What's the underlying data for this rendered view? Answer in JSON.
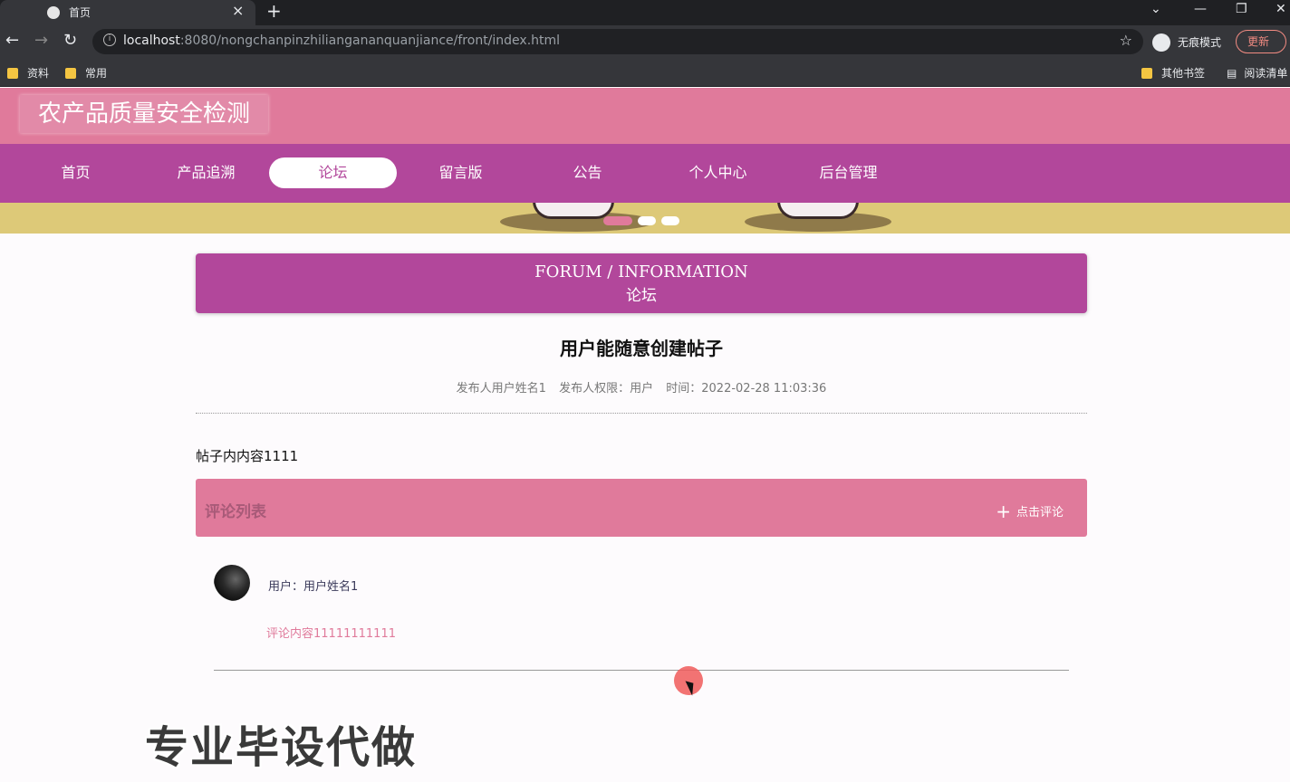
{
  "browser": {
    "tab_title": "首页",
    "new_tab": "+",
    "tab_close": "×",
    "url_host": "localhost",
    "url_rest": ":8080/nongchanpinzhiliangananquanjiance/front/index.html",
    "incognito_label": "无痕模式",
    "update_label": "更新",
    "bookmarks": [
      "资料",
      "常用"
    ],
    "other_bookmarks": "其他书签",
    "reading_list": "阅读清单"
  },
  "site": {
    "title": "农产品质量安全检测",
    "nav": [
      "首页",
      "产品追溯",
      "论坛",
      "留言版",
      "公告",
      "个人中心",
      "后台管理"
    ],
    "active_nav": "论坛",
    "section_en": "FORUM / INFORMATION",
    "section_cn": "论坛"
  },
  "post": {
    "title": "用户能随意创建帖子",
    "meta_author": "发布人用户姓名1",
    "meta_role": "发布人权限：用户",
    "meta_time": "时间：2022-02-28 11:03:36",
    "content": "帖子内内容1111"
  },
  "comments": {
    "header": "评论列表",
    "add_label": "点击评论",
    "items": [
      {
        "user": "用户：用户姓名1",
        "text": "评论内容11111111111"
      }
    ]
  },
  "watermark": "专业毕设代做",
  "colors": {
    "header_pink": "#e07a9b",
    "nav_purple": "#b2479b",
    "banner_yellow": "#ddc978"
  }
}
